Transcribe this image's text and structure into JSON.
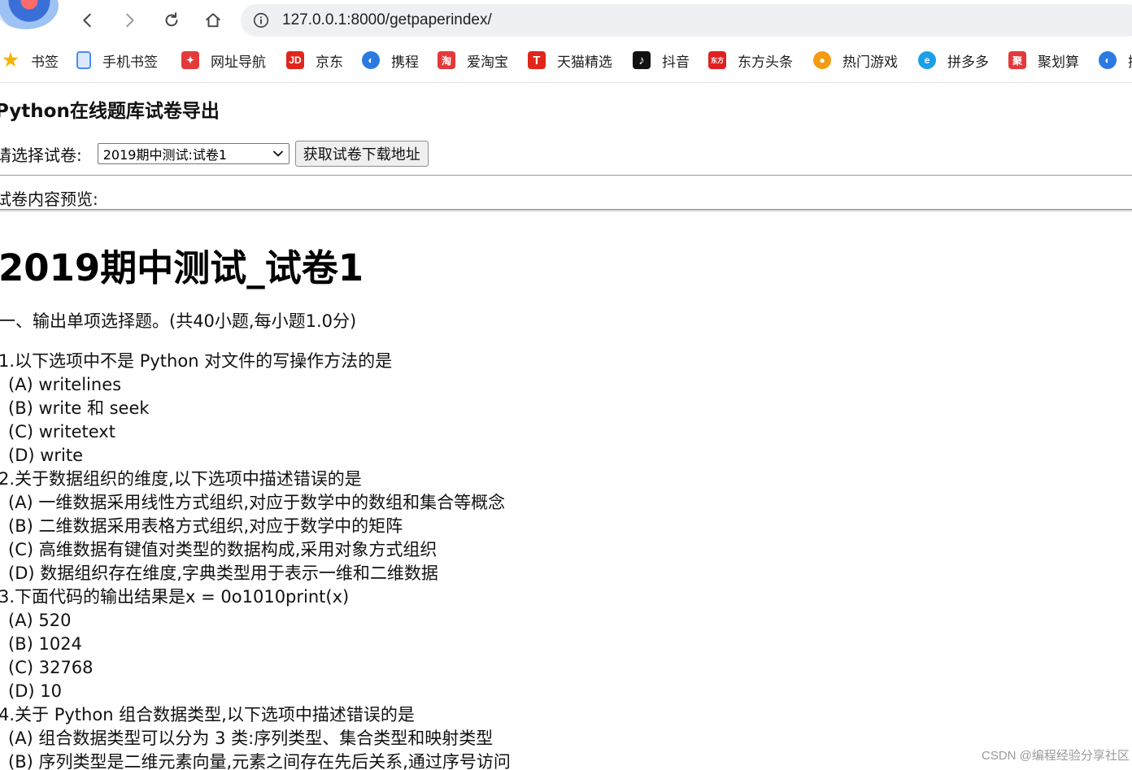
{
  "browser": {
    "url": "127.0.0.1:8000/getpaperindex/",
    "bookmarks": [
      {
        "label": "书签",
        "icon": "star-icon",
        "color": "#f4b400"
      },
      {
        "label": "手机书签",
        "icon": "mobile-icon",
        "color": "#4a8af4"
      },
      {
        "label": "网址导航",
        "icon": "nav-icon",
        "color": "#e33b3b"
      },
      {
        "label": "京东",
        "icon": "jd-icon",
        "color": "#e1251b",
        "glyph": "JD"
      },
      {
        "label": "携程",
        "icon": "ctrip-icon",
        "color": "#2a7ae2"
      },
      {
        "label": "爱淘宝",
        "icon": "taobao-icon",
        "color": "#e4393c",
        "glyph": "淘"
      },
      {
        "label": "天猫精选",
        "icon": "tmall-icon",
        "color": "#e1251b",
        "glyph": "T"
      },
      {
        "label": "抖音",
        "icon": "douyin-icon",
        "color": "#111111",
        "glyph": "♪"
      },
      {
        "label": "东方头条",
        "icon": "dftt-icon",
        "color": "#e02020",
        "glyph": "东方"
      },
      {
        "label": "热门游戏",
        "icon": "game-icon",
        "color": "#f39c12"
      },
      {
        "label": "拼多多",
        "icon": "pdd-icon",
        "color": "#1aa0e8"
      },
      {
        "label": "聚划算",
        "icon": "jhs-icon",
        "color": "#e4393c",
        "glyph": "聚"
      },
      {
        "label": "携",
        "icon": "ctrip2-icon",
        "color": "#2a7ae2"
      }
    ]
  },
  "page": {
    "site_title": "Python在线题库试卷导出",
    "select_label": "请选择试卷:",
    "selected_paper": "2019期中测试:试卷1",
    "get_button": "获取试卷下载地址",
    "preview_label": "试卷内容预览:",
    "paper_title": "2019期中测试_试卷1",
    "section_title": "一、输出单项选择题。(共40小题,每小题1.0分)"
  },
  "questions": [
    {
      "text": "1.以下选项中不是 Python 对文件的写操作方法的是",
      "options": [
        "(A) writelines",
        "(B) write 和 seek",
        "(C) writetext",
        "(D) write"
      ]
    },
    {
      "text": "2.关于数据组织的维度,以下选项中描述错误的是",
      "options": [
        "(A) 一维数据采用线性方式组织,对应于数学中的数组和集合等概念",
        "(B) 二维数据采用表格方式组织,对应于数学中的矩阵",
        "(C) 高维数据有键值对类型的数据构成,采用对象方式组织",
        "(D) 数据组织存在维度,字典类型用于表示一维和二维数据"
      ]
    },
    {
      "text": "3.下面代码的输出结果是x = 0o1010print(x)",
      "options": [
        "(A) 520",
        "(B) 1024",
        "(C) 32768",
        "(D) 10"
      ]
    },
    {
      "text": "4.关于 Python 组合数据类型,以下选项中描述错误的是",
      "options": [
        "(A) 组合数据类型可以分为 3 类:序列类型、集合类型和映射类型",
        "(B) 序列类型是二维元素向量,元素之间存在先后关系,通过序号访问"
      ]
    }
  ],
  "watermark": "CSDN @编程经验分享社区"
}
